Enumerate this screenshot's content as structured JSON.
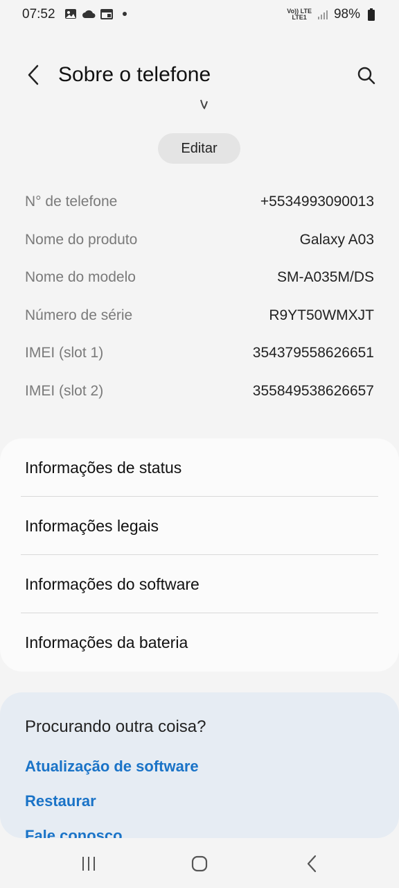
{
  "status_bar": {
    "time": "07:52",
    "left_icons": [
      "image-icon",
      "cloud-icon",
      "calendar-icon",
      "dot-icon"
    ],
    "network_top": "Vo)) LTE",
    "network_bottom": "LTE1",
    "battery": "98%"
  },
  "header": {
    "title": "Sobre o telefone"
  },
  "edit_button": {
    "label": "Editar"
  },
  "info": [
    {
      "label": "N° de telefone",
      "value": "+5534993090013"
    },
    {
      "label": "Nome do produto",
      "value": "Galaxy A03"
    },
    {
      "label": "Nome do modelo",
      "value": "SM-A035M/DS"
    },
    {
      "label": "Número de série",
      "value": "R9YT50WMXJT"
    },
    {
      "label": "IMEI (slot 1)",
      "value": "354379558626651"
    },
    {
      "label": "IMEI (slot 2)",
      "value": "355849538626657"
    }
  ],
  "menu": [
    {
      "label": "Informações de status"
    },
    {
      "label": "Informações legais"
    },
    {
      "label": "Informações do software"
    },
    {
      "label": "Informações da bateria"
    }
  ],
  "suggestions": {
    "title": "Procurando outra coisa?",
    "links": [
      "Atualização de software",
      "Restaurar",
      "Fale conosco"
    ]
  },
  "colors": {
    "background": "#f4f4f4",
    "card": "#fbfbfb",
    "suggest_bg": "#e6ecf3",
    "link": "#1a73c7"
  }
}
